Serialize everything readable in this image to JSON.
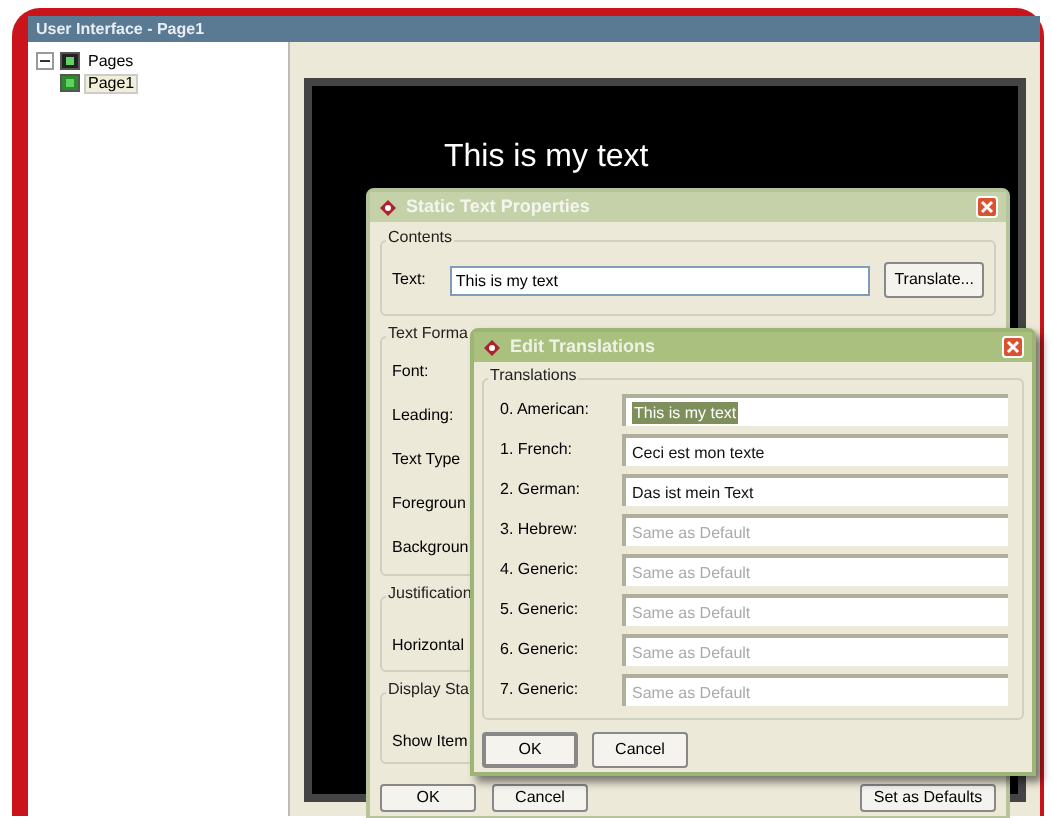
{
  "window": {
    "title": "User Interface - Page1"
  },
  "tree": [
    {
      "label": "Pages",
      "expanded": true,
      "children": [
        {
          "label": "Page1",
          "selected": true
        }
      ]
    }
  ],
  "canvas": {
    "text": "This is my text"
  },
  "static_text_dialog": {
    "title": "Static Text Properties",
    "contents_group": "Contents",
    "text_label": "Text:",
    "text_value": "This is my text",
    "translate_button": "Translate...",
    "format_group": "Text Forma",
    "format_labels": [
      "Font:",
      "Leading:",
      "Text Type",
      "Foregroun",
      "Backgroun"
    ],
    "justification_group": "Justification",
    "justification_labels": [
      "Horizontal"
    ],
    "display_group": "Display Sta",
    "display_labels": [
      "Show Item"
    ],
    "buttons": [
      "OK",
      "Cancel",
      "Set as Defaults"
    ]
  },
  "translations_dialog": {
    "title": "Edit Translations",
    "group": "Translations",
    "rows": [
      {
        "label": "0. American:",
        "value": "This is my text",
        "selected": true
      },
      {
        "label": "1. French:",
        "value": "Ceci est mon texte",
        "selected": false
      },
      {
        "label": "2. German:",
        "value": "Das ist mein Text",
        "selected": false
      },
      {
        "label": "3. Hebrew:",
        "placeholder": "Same as Default",
        "selected": false
      },
      {
        "label": "4. Generic:",
        "placeholder": "Same as Default",
        "selected": false
      },
      {
        "label": "5. Generic:",
        "placeholder": "Same as Default",
        "selected": false
      },
      {
        "label": "6. Generic:",
        "placeholder": "Same as Default",
        "selected": false
      },
      {
        "label": "7. Generic:",
        "placeholder": "Same as Default",
        "selected": false
      }
    ],
    "buttons": [
      "OK",
      "Cancel"
    ]
  }
}
